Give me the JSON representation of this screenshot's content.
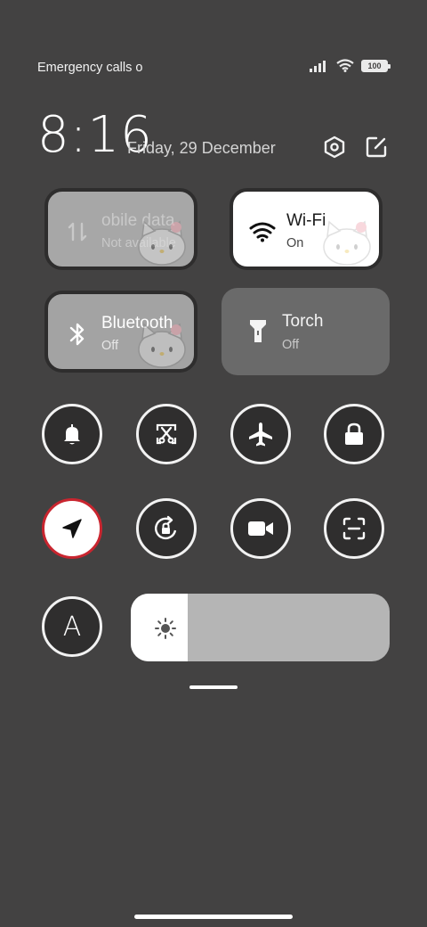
{
  "status": {
    "carrier": "Emergency calls o",
    "battery": "100"
  },
  "header": {
    "time": "8:16",
    "date": "Friday, 29 December",
    "icons": [
      "settings-hex-icon",
      "edit-icon"
    ]
  },
  "tiles": {
    "mobile_data": {
      "title": "obile data",
      "subtitle": "Not available",
      "icon": "mobile-data-icon",
      "state": "unavailable"
    },
    "wifi": {
      "title": "Wi-Fi",
      "subtitle": "On",
      "icon": "wifi-icon",
      "state": "on"
    },
    "bluetooth": {
      "title": "Bluetooth",
      "subtitle": "Off",
      "icon": "bluetooth-icon",
      "state": "off"
    },
    "torch": {
      "title": "Torch",
      "subtitle": "Off",
      "icon": "torch-icon",
      "state": "off"
    }
  },
  "toggles": [
    {
      "icon": "bell-icon",
      "state": "off"
    },
    {
      "icon": "screenshot-icon",
      "state": "off"
    },
    {
      "icon": "airplane-icon",
      "state": "off"
    },
    {
      "icon": "lock-icon",
      "state": "off"
    },
    {
      "icon": "location-icon",
      "state": "on"
    },
    {
      "icon": "rotation-lock-icon",
      "state": "off"
    },
    {
      "icon": "video-camera-icon",
      "state": "off"
    },
    {
      "icon": "scanner-icon",
      "state": "off"
    },
    {
      "icon": "auto-brightness-icon",
      "label": "A",
      "state": "off"
    }
  ],
  "brightness": {
    "level": 0.22,
    "icon": "sun-icon"
  },
  "colors": {
    "background": "#434242",
    "active_border": "#c9252f",
    "tile_on": "#ffffff"
  }
}
